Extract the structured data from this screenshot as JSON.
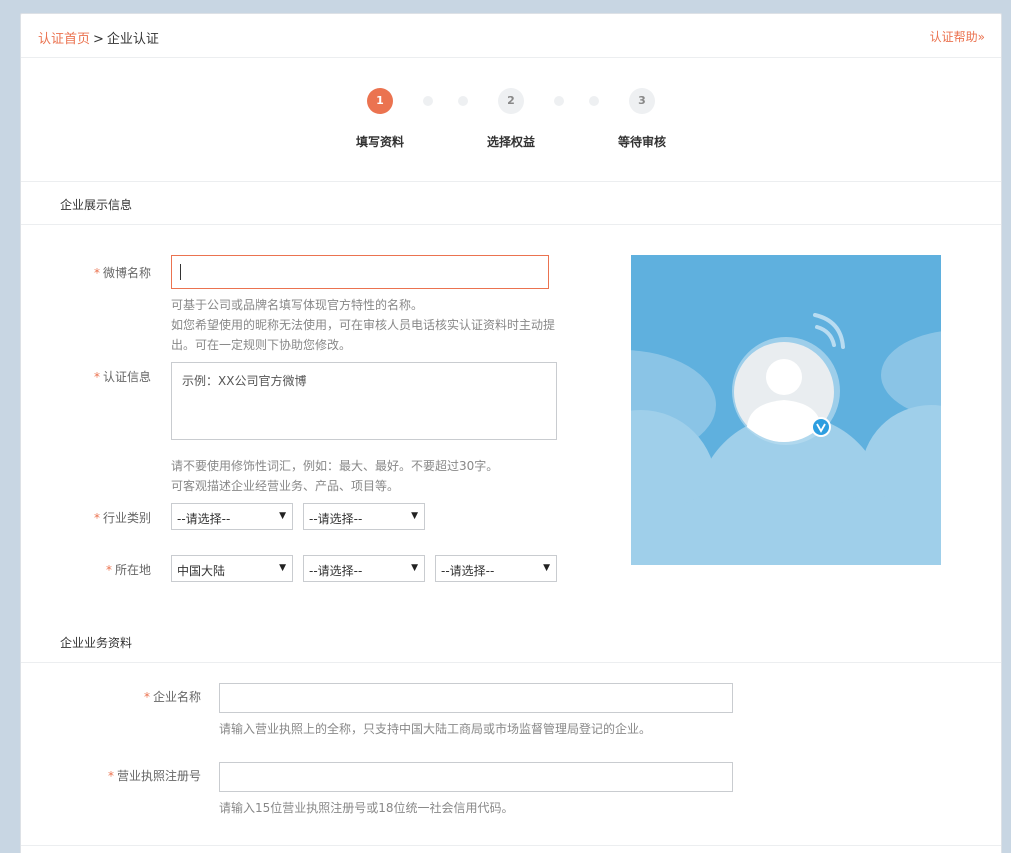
{
  "breadcrumb": {
    "home": "认证首页",
    "separator": ">",
    "current": "企业认证"
  },
  "help_link": "认证帮助»",
  "steps": [
    {
      "number": "1",
      "label": "填写资料",
      "active": true
    },
    {
      "number": "2",
      "label": "选择权益",
      "active": false
    },
    {
      "number": "3",
      "label": "等待审核",
      "active": false
    }
  ],
  "section1": {
    "title": "企业展示信息",
    "weibo_name": {
      "required": "*",
      "label": "微博名称",
      "value": "",
      "hint1": "可基于公司或品牌名填写体现官方特性的名称。",
      "hint2": "如您希望使用的昵称无法使用，可在审核人员电话核实认证资料时主动提",
      "hint3": "出。可在一定规则下协助您修改。"
    },
    "verify_info": {
      "required": "*",
      "label": "认证信息",
      "placeholder": "示例：XX公司官方微博",
      "hint1": "请不要使用修饰性词汇，例如：最大、最好。不要超过30字。",
      "hint2": "可客观描述企业经营业务、产品、项目等。"
    },
    "industry": {
      "required": "*",
      "label": "行业类别",
      "select1": "--请选择--",
      "select2": "--请选择--"
    },
    "location": {
      "required": "*",
      "label": "所在地",
      "select1": "中国大陆",
      "select2": "--请选择--",
      "select3": "--请选择--"
    }
  },
  "section2": {
    "title": "企业业务资料",
    "company_name": {
      "required": "*",
      "label": "企业名称",
      "value": "",
      "hint": "请输入营业执照上的全称，只支持中国大陆工商局或市场监督管理局登记的企业。"
    },
    "license_no": {
      "required": "*",
      "label": "营业执照注册号",
      "value": "",
      "hint": "请输入15位营业执照注册号或18位统一社会信用代码。"
    }
  },
  "colors": {
    "accent": "#eb7350",
    "preview_sky": "#5fb0de",
    "badge": "#2d9ee0"
  },
  "icons": {
    "dropdown": "triangle-down-icon",
    "verified": "verified-v-icon",
    "signal": "signal-wave-icon",
    "avatar": "avatar-silhouette-icon"
  }
}
